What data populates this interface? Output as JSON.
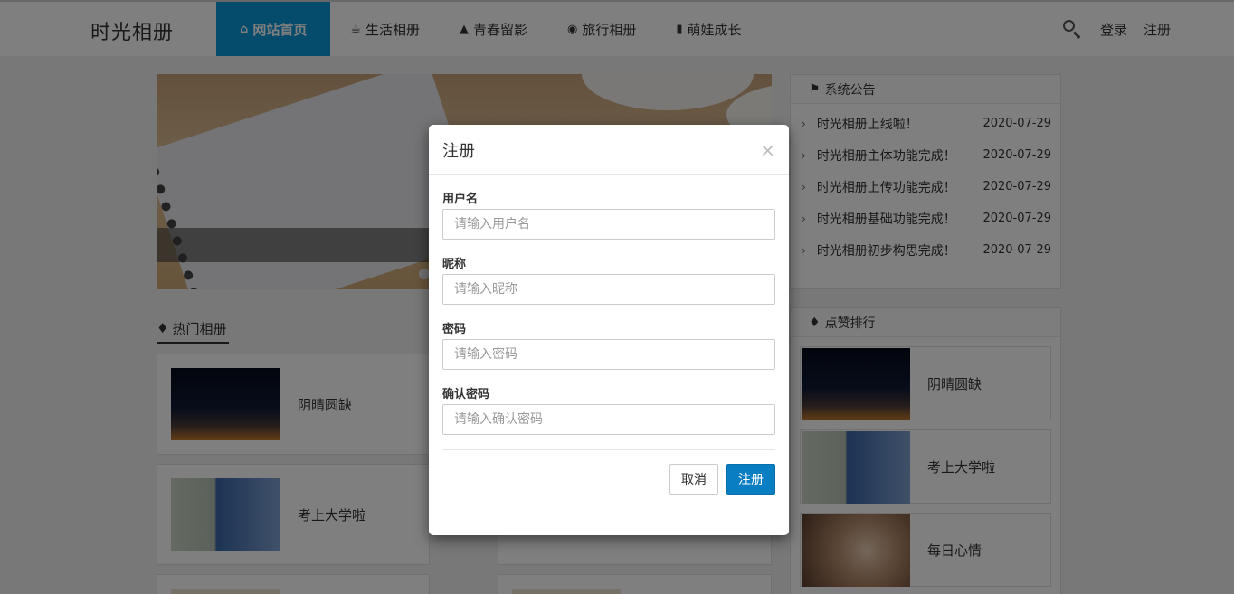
{
  "header": {
    "brand": "时光相册",
    "nav": [
      {
        "label": "网站首页",
        "icon": "home-icon",
        "active": true
      },
      {
        "label": "生活相册",
        "icon": "coffee-icon"
      },
      {
        "label": "青春留影",
        "icon": "graduation-cap-icon"
      },
      {
        "label": "旅行相册",
        "icon": "camera-icon"
      },
      {
        "label": "萌娃成长",
        "icon": "bookmark-icon"
      }
    ],
    "login": "登录",
    "register": "注册"
  },
  "hot": {
    "tab_label": "热门相册",
    "cards": [
      {
        "title": "阴晴圆缺"
      },
      {
        "title": "考上大学啦"
      }
    ]
  },
  "notice": {
    "title": "系统公告",
    "items": [
      {
        "text": "时光相册上线啦！",
        "date": "2020-07-29"
      },
      {
        "text": "时光相册主体功能完成！",
        "date": "2020-07-29"
      },
      {
        "text": "时光相册上传功能完成！",
        "date": "2020-07-29"
      },
      {
        "text": "时光相册基础功能完成！",
        "date": "2020-07-29"
      },
      {
        "text": "时光相册初步构思完成！",
        "date": "2020-07-29"
      }
    ]
  },
  "ranking": {
    "title": "点赞排行",
    "items": [
      {
        "title": "阴晴圆缺"
      },
      {
        "title": "考上大学啦"
      },
      {
        "title": "每日心情"
      }
    ]
  },
  "modal": {
    "title": "注册",
    "close": "×",
    "fields": [
      {
        "label": "用户名",
        "placeholder": "请输入用户名"
      },
      {
        "label": "昵称",
        "placeholder": "请输入昵称"
      },
      {
        "label": "密码",
        "placeholder": "请输入密码"
      },
      {
        "label": "确认密码",
        "placeholder": "请输入确认密码"
      }
    ],
    "cancel": "取消",
    "submit": "注册"
  },
  "colors": {
    "accent": "#0a96d6",
    "primary_button": "#0a7ec2"
  }
}
